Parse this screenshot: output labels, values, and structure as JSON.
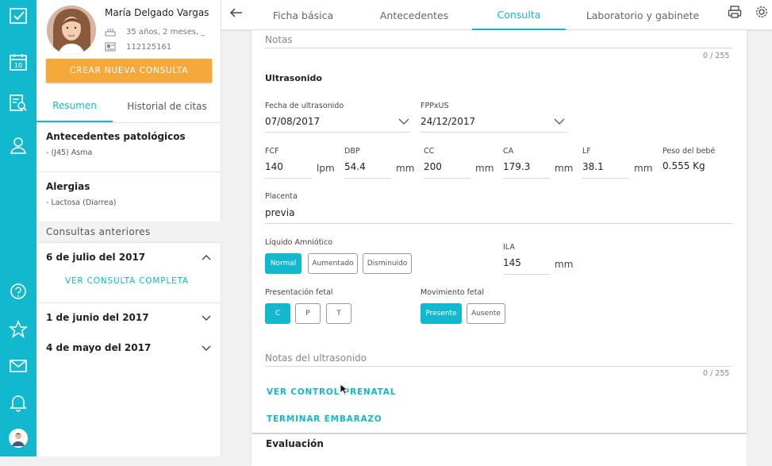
{
  "patient": {
    "name": "María Delgado Vargas",
    "age": "35 años, 2 meses, _",
    "id": "112125161"
  },
  "left_panel": {
    "new_consult_label": "CREAR NUEVA CONSULTA",
    "tabs": [
      {
        "label": "Resumen",
        "active": true
      },
      {
        "label": "Historial de citas",
        "active": false
      }
    ],
    "pathologic": {
      "title": "Antecedentes patológicos",
      "items": [
        "- (J45) Asma"
      ]
    },
    "allergies": {
      "title": "Alergias",
      "items": [
        "- Lactosa (Diarrea)"
      ]
    },
    "previous_title": "Consultas anteriores",
    "previous": [
      {
        "date": "6 de julio del 2017",
        "expanded": true,
        "action": "VER CONSULTA COMPLETA"
      },
      {
        "date": "1 de junio del 2017",
        "expanded": false
      },
      {
        "date": "4 de mayo del 2017",
        "expanded": false
      }
    ]
  },
  "top_tabs": [
    {
      "label": "Ficha básica",
      "active": false
    },
    {
      "label": "Antecedentes",
      "active": false
    },
    {
      "label": "Consulta",
      "active": true
    },
    {
      "label": "Laboratorio y gabinete",
      "active": false
    }
  ],
  "form": {
    "notes_placeholder": "Notas",
    "notes_counter": "0 / 255",
    "ultrasound_title": "Ultrasonido",
    "us_date": {
      "label": "Fecha de ultrasonido",
      "value": "07/08/2017"
    },
    "fpp": {
      "label": "FPPxUS",
      "value": "24/12/2017"
    },
    "measures": [
      {
        "label": "FCF",
        "value": "140",
        "unit": "lpm"
      },
      {
        "label": "DBP",
        "value": "54.4",
        "unit": "mm"
      },
      {
        "label": "CC",
        "value": "200",
        "unit": "mm"
      },
      {
        "label": "CA",
        "value": "179.3",
        "unit": "mm"
      },
      {
        "label": "LF",
        "value": "38.1",
        "unit": "mm"
      }
    ],
    "weight": {
      "label": "Peso del bebé",
      "value": "0.555 Kg"
    },
    "placenta": {
      "label": "Placenta",
      "value": "previa"
    },
    "amniotic": {
      "label": "Líquido Amniótico",
      "options": [
        "Normal",
        "Aumentado",
        "Disminuido"
      ],
      "selected": "Normal"
    },
    "ila": {
      "label": "ILA",
      "value": "145",
      "unit": "mm"
    },
    "presentation": {
      "label": "Presentación fetal",
      "options": [
        "C",
        "P",
        "T"
      ],
      "selected": "C"
    },
    "movement": {
      "label": "Movimiento fetal",
      "options": [
        "Presente",
        "Ausente"
      ],
      "selected": "Presente"
    },
    "us_notes_placeholder": "Notas del ultrasonido",
    "us_notes_counter": "0 / 255",
    "link_prenatal": "VER CONTROL PRENATAL",
    "link_end": "TERMINAR EMBARAZO",
    "evaluation_title": "Evaluación"
  },
  "colors": {
    "accent": "#12b8ce",
    "orange": "#f6a93b"
  },
  "icons": {
    "rail": [
      "logo-icon",
      "calendar-icon",
      "records-search-icon",
      "patient-icon",
      "help-icon",
      "star-icon",
      "mail-icon",
      "bell-icon",
      "user-avatar"
    ],
    "top": [
      "back-arrow-icon",
      "print-icon",
      "settings-icon"
    ]
  }
}
